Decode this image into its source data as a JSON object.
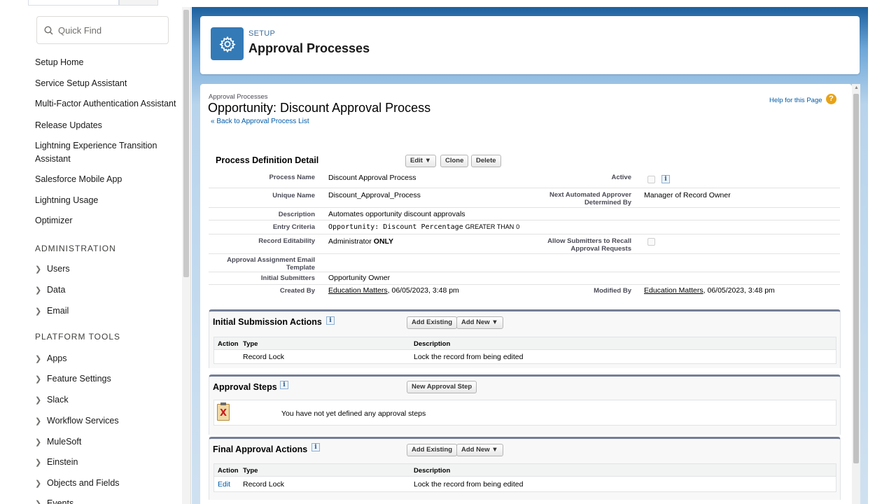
{
  "sidebar": {
    "search_placeholder": "Quick Find",
    "links": [
      "Setup Home",
      "Service Setup Assistant",
      "Multi-Factor Authentication Assistant",
      "Release Updates",
      "Lightning Experience Transition Assistant",
      "Salesforce Mobile App",
      "Lightning Usage",
      "Optimizer"
    ],
    "admin_heading": "ADMINISTRATION",
    "admin_items": [
      "Users",
      "Data",
      "Email"
    ],
    "platform_heading": "PLATFORM TOOLS",
    "platform_items": [
      "Apps",
      "Feature Settings",
      "Slack",
      "Workflow Services",
      "MuleSoft",
      "Einstein",
      "Objects and Fields",
      "Events"
    ]
  },
  "header": {
    "kicker": "SETUP",
    "title": "Approval Processes",
    "icon": "gear-icon"
  },
  "page": {
    "breadcrumb": "Approval Processes",
    "title": "Opportunity: Discount Approval Process",
    "back_link": "« Back to Approval Process List",
    "help_link": "Help for this Page",
    "help_icon": "?"
  },
  "detail": {
    "title": "Process Definition Detail",
    "buttons": {
      "edit": "Edit ▼",
      "clone": "Clone",
      "delete": "Delete"
    },
    "labels": {
      "process_name": "Process Name",
      "unique_name": "Unique Name",
      "description": "Description",
      "entry_criteria": "Entry Criteria",
      "record_editability": "Record Editability",
      "email_template": "Approval Assignment Email Template",
      "initial_submitters": "Initial Submitters",
      "created_by": "Created By",
      "active": "Active",
      "next_approver": "Next Automated Approver Determined By",
      "allow_recall": "Allow Submitters to Recall Approval Requests",
      "modified_by": "Modified By"
    },
    "values": {
      "process_name": "Discount Approval Process",
      "unique_name": "Discount_Approval_Process",
      "description": "Automates opportunity discount approvals",
      "entry_field": "Opportunity: Discount Percentage",
      "entry_operator": "GREATER THAN",
      "entry_value": "0",
      "record_editability_prefix": "Administrator ",
      "record_editability_suffix": "ONLY",
      "initial_submitters": "Opportunity Owner",
      "created_by_user": "Education Matters",
      "created_by_date": ", 06/05/2023, 3:48 pm",
      "next_approver": "Manager of Record Owner",
      "modified_by_user": "Education Matters",
      "modified_by_date": ", 06/05/2023, 3:48 pm",
      "active_checked": false,
      "allow_recall_checked": false
    }
  },
  "initial_submission": {
    "title": "Initial Submission Actions",
    "buttons": {
      "add_existing": "Add Existing",
      "add_new": "Add New ▼"
    },
    "columns": [
      "Action",
      "Type",
      "Description"
    ],
    "rows": [
      {
        "action": "",
        "type": "Record Lock",
        "description": "Lock the record from being edited"
      }
    ]
  },
  "approval_steps": {
    "title": "Approval Steps",
    "button": "New Approval Step",
    "empty_message": "You have not yet defined any approval steps",
    "empty_icon": "X"
  },
  "final_approval": {
    "title": "Final Approval Actions",
    "buttons": {
      "add_existing": "Add Existing",
      "add_new": "Add New ▼"
    },
    "columns": [
      "Action",
      "Type",
      "Description"
    ],
    "rows": [
      {
        "action": "Edit",
        "type": "Record Lock",
        "description": "Lock the record from being edited"
      }
    ]
  },
  "info_glyph": "i"
}
